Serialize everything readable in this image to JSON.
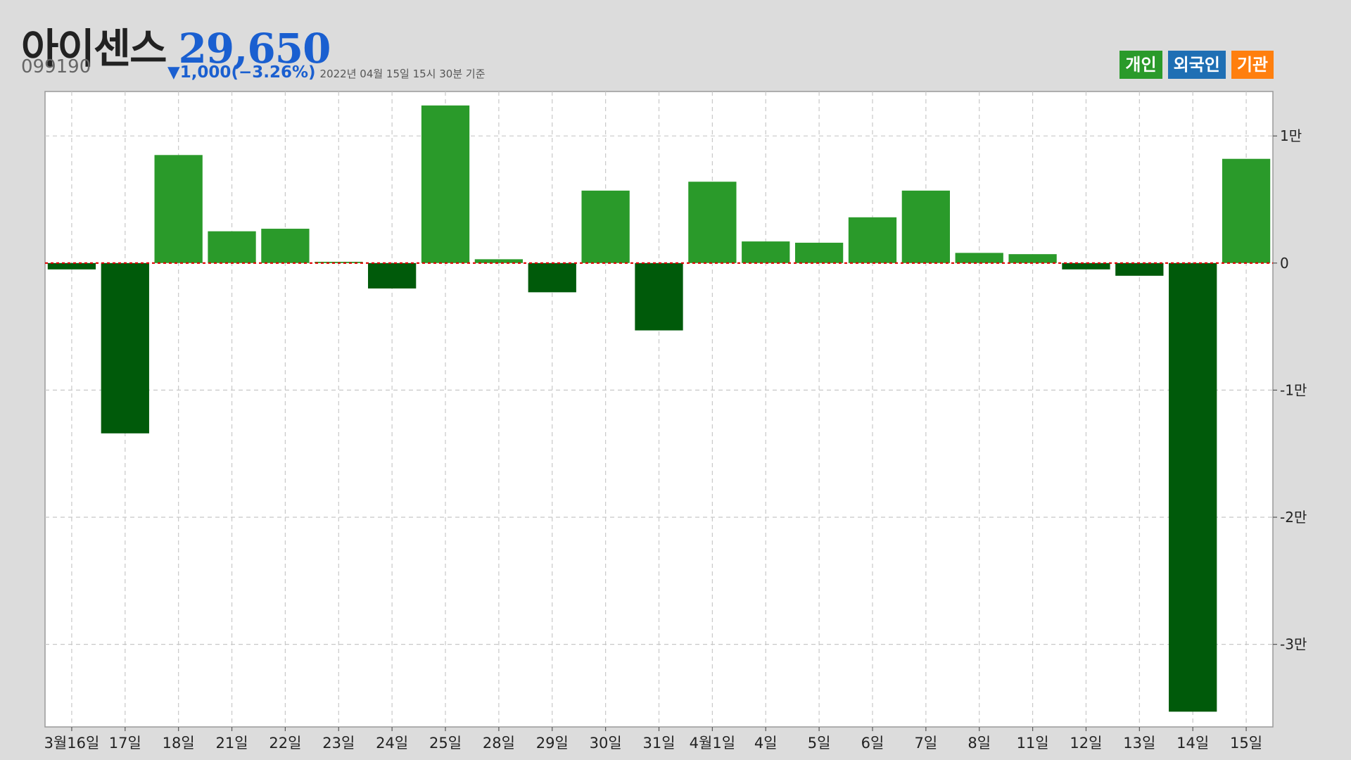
{
  "header": {
    "name": "아이센스",
    "price": "29,650",
    "code": "099190",
    "change": "▼1,000(−3.26%)",
    "as_of": "2022년 04월 15일 15시 30분 기준"
  },
  "legend": {
    "individual": "개인",
    "foreign": "외국인",
    "institution": "기관"
  },
  "colors": {
    "positive": "#2a9a2a",
    "negative": "#005a0a",
    "individual": "#2a9a2a",
    "foreign": "#1f6fb4",
    "institution": "#ff7f0e",
    "zero_line": "#e00000"
  },
  "chart_data": {
    "type": "bar",
    "series": [
      {
        "name": "개인",
        "values": [
          -500,
          -13400,
          8500,
          2500,
          2700,
          100,
          -2000,
          12400,
          300,
          -2300,
          5700,
          -5300,
          6400,
          1700,
          1600,
          3600,
          5700,
          800,
          700,
          -500,
          -1000,
          -35300,
          8200
        ]
      }
    ],
    "categories": [
      "3월16일",
      "17일",
      "18일",
      "21일",
      "22일",
      "23일",
      "24일",
      "25일",
      "28일",
      "29일",
      "30일",
      "31일",
      "4월1일",
      "4일",
      "5일",
      "6일",
      "7일",
      "8일",
      "11일",
      "12일",
      "13일",
      "14일",
      "15일"
    ],
    "y_ticks": [
      {
        "value": 10000,
        "label": "1만"
      },
      {
        "value": 0,
        "label": "0"
      },
      {
        "value": -10000,
        "label": "-1만"
      },
      {
        "value": -20000,
        "label": "-2만"
      },
      {
        "value": -30000,
        "label": "-3만"
      }
    ],
    "ylim": [
      -36500,
      13500
    ],
    "grid": true,
    "y_axis_position": "right"
  }
}
